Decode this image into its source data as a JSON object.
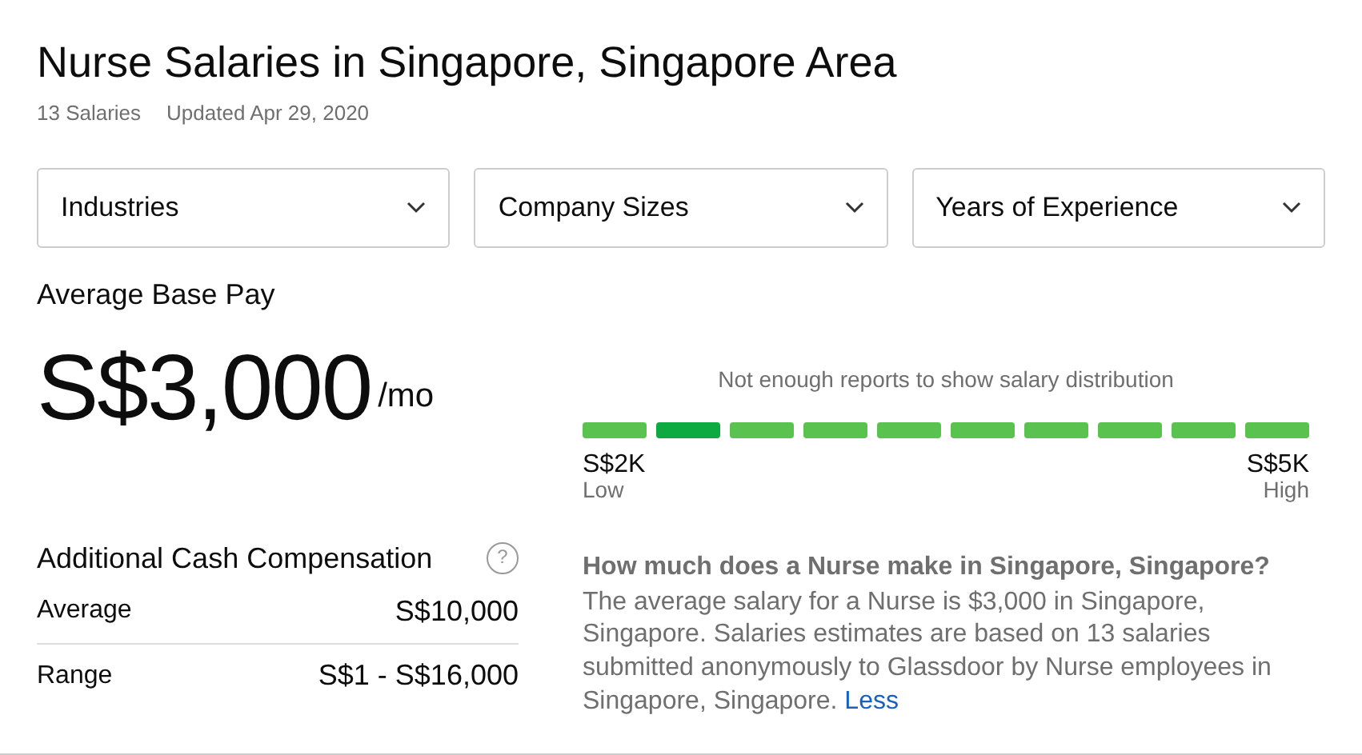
{
  "title": "Nurse Salaries in Singapore, Singapore Area",
  "meta": [
    "13 Salaries",
    "Updated Apr 29, 2020"
  ],
  "filters": [
    {
      "label": "Industries"
    },
    {
      "label": "Company Sizes"
    },
    {
      "label": "Years of Experience"
    }
  ],
  "pay": {
    "label": "Average Base Pay",
    "amount": "S$3,000",
    "unit": "/mo"
  },
  "distribution": {
    "note": "Not enough reports to show salary distribution",
    "segments": [
      {
        "selected": false
      },
      {
        "selected": true
      },
      {
        "selected": false
      },
      {
        "selected": false
      },
      {
        "selected": false
      },
      {
        "selected": false
      },
      {
        "selected": false
      },
      {
        "selected": false
      },
      {
        "selected": false
      },
      {
        "selected": false
      }
    ],
    "low": {
      "value": "S$2K",
      "label": "Low"
    },
    "high": {
      "value": "S$5K",
      "label": "High"
    }
  },
  "cash": {
    "title": "Additional Cash Compensation",
    "help": "?",
    "rows": [
      {
        "label": "Average",
        "value": "S$10,000"
      },
      {
        "label": "Range",
        "value": "S$1 - S$16,000"
      }
    ]
  },
  "faq": {
    "question": "How much does a Nurse make in Singapore, Singapore?",
    "answer": "The average salary for a Nurse is $3,000 in Singapore, Singapore. Salaries estimates are based on 13 salaries submitted anonymously to Glassdoor by Nurse employees in Singapore, Singapore.",
    "link": "Less"
  }
}
